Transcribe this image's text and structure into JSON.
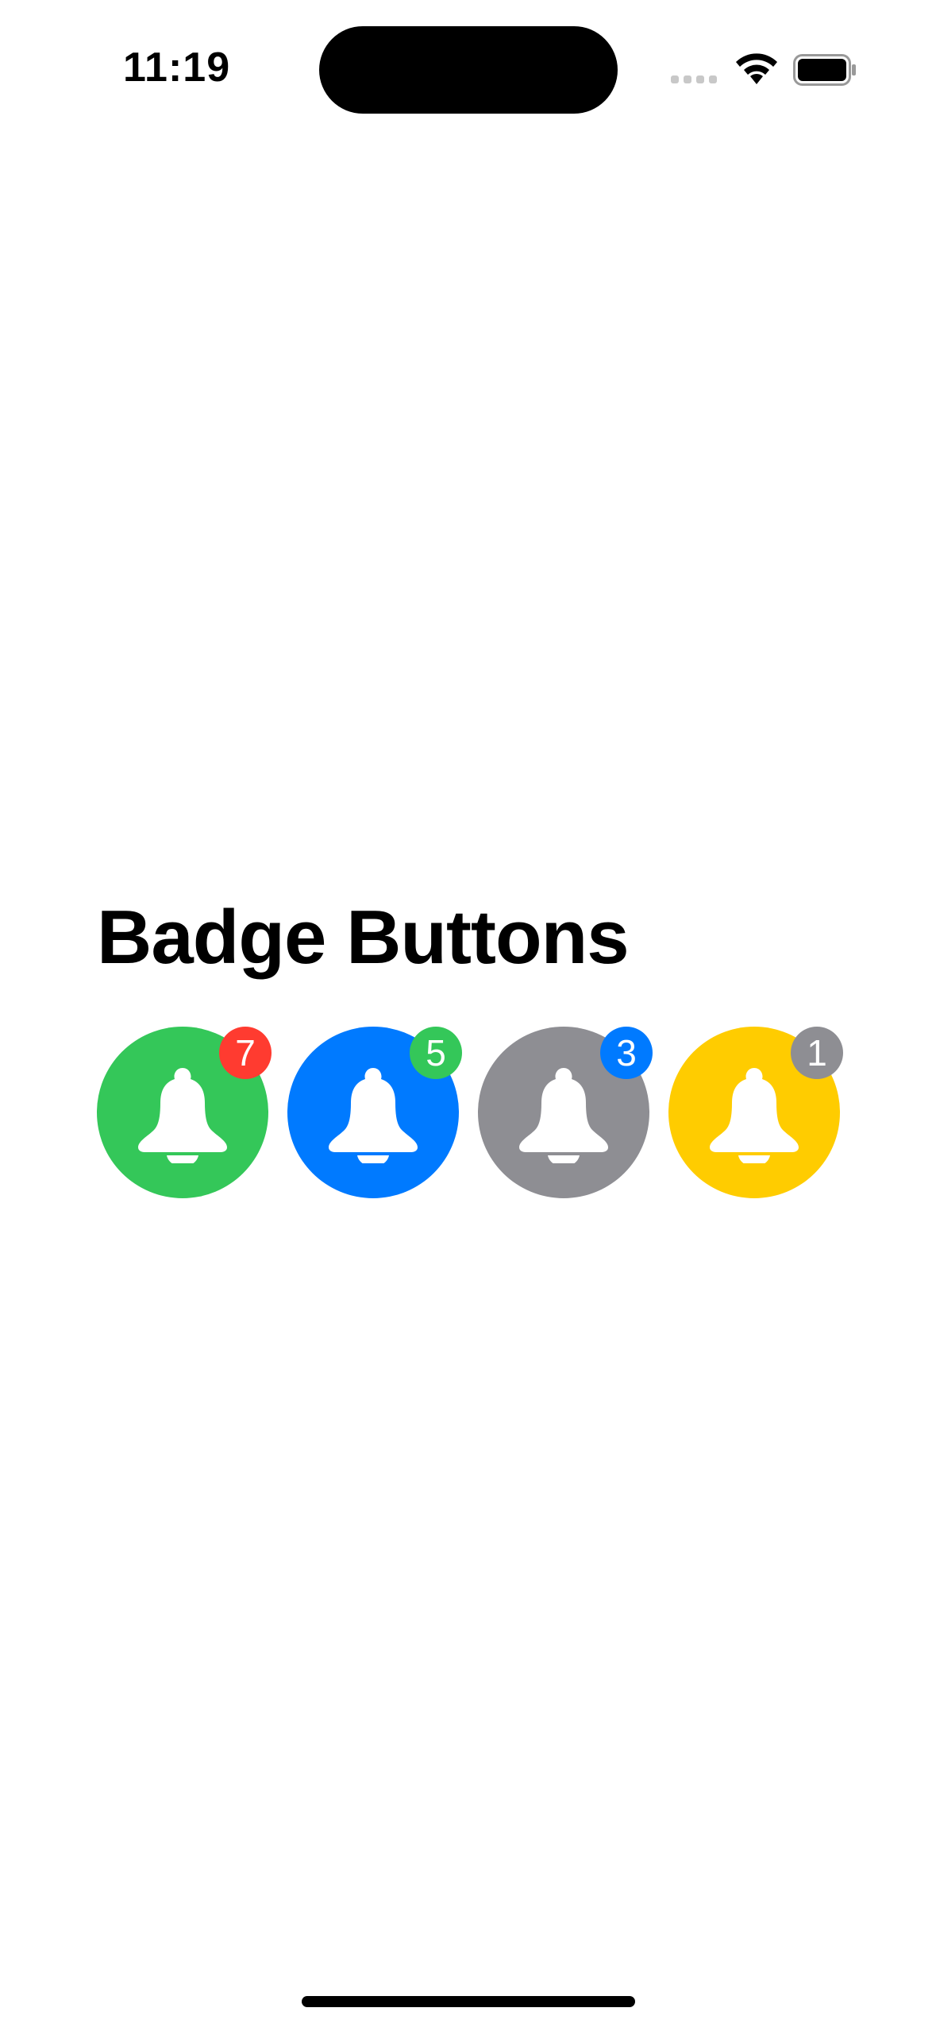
{
  "status_bar": {
    "time": "11:19",
    "icons": [
      "signal-icon",
      "wifi-icon",
      "battery-icon"
    ]
  },
  "title": "Badge Buttons",
  "badge_buttons": [
    {
      "icon": "bell-icon",
      "count": "7",
      "color": "#34C759",
      "badge_color": "#FF3B30"
    },
    {
      "icon": "bell-icon",
      "count": "5",
      "color": "#007AFF",
      "badge_color": "#34C759"
    },
    {
      "icon": "bell-icon",
      "count": "3",
      "color": "#8E8E93",
      "badge_color": "#007AFF"
    },
    {
      "icon": "bell-icon",
      "count": "1",
      "color": "#FFCC00",
      "badge_color": "#8E8E93"
    }
  ]
}
